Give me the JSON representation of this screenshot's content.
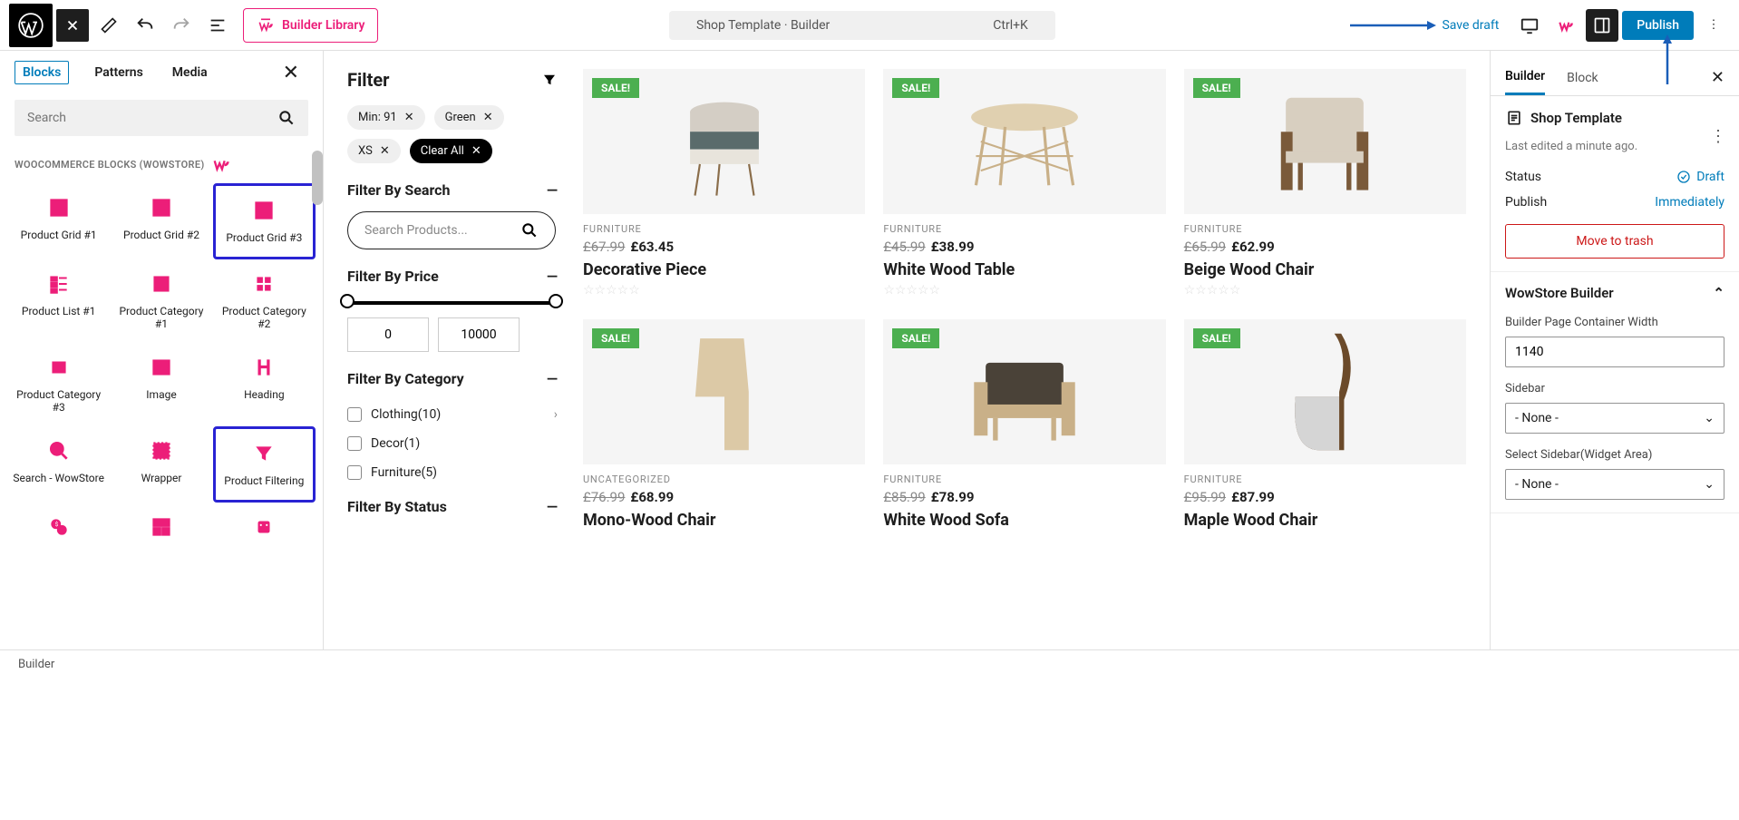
{
  "topbar": {
    "builder_library": "Builder Library",
    "title": "Shop Template · Builder",
    "shortcut": "Ctrl+K",
    "save_draft": "Save draft",
    "publish": "Publish"
  },
  "left": {
    "tabs": {
      "blocks": "Blocks",
      "patterns": "Patterns",
      "media": "Media"
    },
    "search_placeholder": "Search",
    "section_title": "WOOCOMMERCE BLOCKS (WOWSTORE)",
    "blocks": [
      "Product Grid #1",
      "Product Grid #2",
      "Product Grid #3",
      "Product List #1",
      "Product Category #1",
      "Product Category #2",
      "Product Category #3",
      "Image",
      "Heading",
      "Search - WowStore",
      "Wrapper",
      "Product Filtering"
    ]
  },
  "filter": {
    "title": "Filter",
    "chips": [
      "Min: 91",
      "Green",
      "XS"
    ],
    "clear_all": "Clear All",
    "by_search": "Filter By Search",
    "search_placeholder": "Search Products...",
    "by_price": "Filter By Price",
    "price_min": "0",
    "price_max": "10000",
    "by_category": "Filter By Category",
    "categories": [
      "Clothing(10)",
      "Decor(1)",
      "Furniture(5)"
    ],
    "by_status": "Filter By Status"
  },
  "products": [
    {
      "sale": "SALE!",
      "cat": "FURNITURE",
      "old": "£67.99",
      "new": "£63.45",
      "name": "Decorative Piece"
    },
    {
      "sale": "SALE!",
      "cat": "FURNITURE",
      "old": "£45.99",
      "new": "£38.99",
      "name": "White Wood Table"
    },
    {
      "sale": "SALE!",
      "cat": "FURNITURE",
      "old": "£65.99",
      "new": "£62.99",
      "name": "Beige Wood Chair"
    },
    {
      "sale": "SALE!",
      "cat": "UNCATEGORIZED",
      "old": "£76.99",
      "new": "£68.99",
      "name": "Mono-Wood Chair"
    },
    {
      "sale": "SALE!",
      "cat": "FURNITURE",
      "old": "£85.99",
      "new": "£78.99",
      "name": "White Wood Sofa"
    },
    {
      "sale": "SALE!",
      "cat": "FURNITURE",
      "old": "£95.99",
      "new": "£87.99",
      "name": "Maple Wood Chair"
    }
  ],
  "right": {
    "tabs": {
      "builder": "Builder",
      "block": "Block"
    },
    "doc_title": "Shop Template",
    "last_edited": "Last edited a minute ago.",
    "status_label": "Status",
    "status_value": "Draft",
    "publish_label": "Publish",
    "publish_value": "Immediately",
    "trash": "Move to trash",
    "wowstore_title": "WowStore Builder",
    "width_label": "Builder Page Container Width",
    "width_value": "1140",
    "sidebar_label": "Sidebar",
    "sidebar_value": "- None -",
    "widget_label": "Select Sidebar(Widget Area)",
    "widget_value": "- None -"
  },
  "footer": "Builder"
}
